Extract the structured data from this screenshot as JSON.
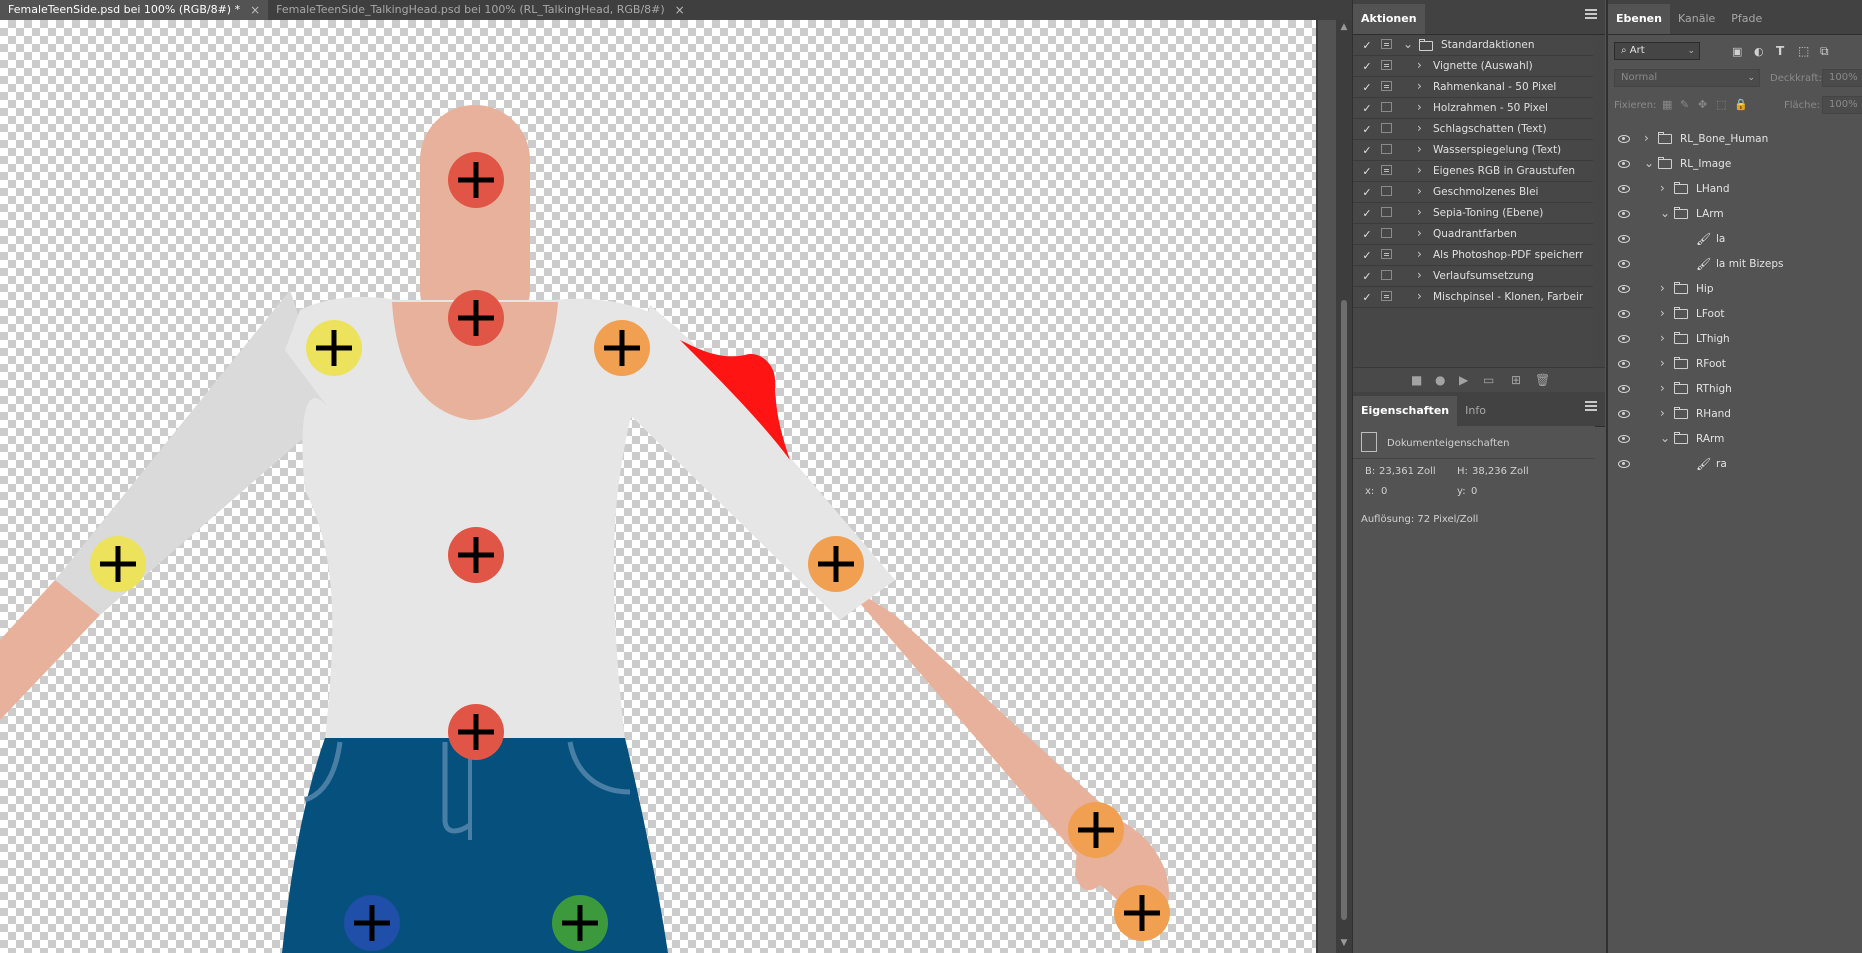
{
  "tabs": [
    {
      "label": "FemaleTeenSide.psd bei 100% (RGB/8#) *",
      "close": "×",
      "active": true
    },
    {
      "label": "FemaleTeenSide_TalkingHead.psd bei 100% (RL_TalkingHead, RGB/8#)",
      "close": "×",
      "active": false
    }
  ],
  "actions": {
    "tab_label": "Aktionen",
    "set": {
      "label": "Standardaktionen",
      "checked": true
    },
    "items": [
      {
        "label": "Vignette (Auswahl)",
        "dialog": true
      },
      {
        "label": "Rahmenkanal - 50 Pixel",
        "dialog": true
      },
      {
        "label": "Holzrahmen - 50 Pixel",
        "dialog": false
      },
      {
        "label": "Schlagschatten (Text)",
        "dialog": false
      },
      {
        "label": "Wasserspiegelung (Text)",
        "dialog": false
      },
      {
        "label": "Eigenes RGB in Graustufen",
        "dialog": true
      },
      {
        "label": "Geschmolzenes Blei",
        "dialog": false
      },
      {
        "label": "Sepia-Toning (Ebene)",
        "dialog": false
      },
      {
        "label": "Quadrantfarben",
        "dialog": false
      },
      {
        "label": "Als Photoshop-PDF speichern",
        "dialog": true
      },
      {
        "label": "Verlaufsumsetzung",
        "dialog": false
      },
      {
        "label": "Mischpinsel - Klonen, Farbeinr...",
        "dialog": true
      }
    ],
    "toolbar_icons": [
      "stop-icon",
      "record-icon",
      "play-icon",
      "new-set-icon",
      "new-action-icon",
      "delete-icon"
    ]
  },
  "properties": {
    "tabs": [
      "Eigenschaften",
      "Info"
    ],
    "section_title": "Dokumenteigenschaften",
    "width_label": "B:",
    "width_value": "23,361 Zoll",
    "height_label": "H:",
    "height_value": "38,236 Zoll",
    "x_label": "x:",
    "x_value": "0",
    "y_label": "y:",
    "y_value": "0",
    "resolution": "Auflösung: 72 Pixel/Zoll"
  },
  "layers": {
    "tabs": [
      "Ebenen",
      "Kanäle",
      "Pfade"
    ],
    "filter_kind": "Art",
    "blend_mode": "Normal",
    "opacity_label": "Deckkraft:",
    "opacity_value": "100%",
    "lock_label": "Fixieren:",
    "fill_label": "Fläche:",
    "fill_value": "100%",
    "items": [
      {
        "name": "RL_Bone_Human",
        "type": "group",
        "expanded": false,
        "depth": 0
      },
      {
        "name": "RL_Image",
        "type": "group",
        "expanded": true,
        "depth": 0
      },
      {
        "name": "LHand",
        "type": "group",
        "expanded": false,
        "depth": 1
      },
      {
        "name": "LArm",
        "type": "group",
        "expanded": true,
        "depth": 1
      },
      {
        "name": "la",
        "type": "layer",
        "depth": 2
      },
      {
        "name": "la mit Bizeps",
        "type": "layer",
        "depth": 2
      },
      {
        "name": "Hip",
        "type": "group",
        "expanded": false,
        "depth": 1
      },
      {
        "name": "LFoot",
        "type": "group",
        "expanded": false,
        "depth": 1
      },
      {
        "name": "LThigh",
        "type": "group",
        "expanded": false,
        "depth": 1
      },
      {
        "name": "RFoot",
        "type": "group",
        "expanded": false,
        "depth": 1
      },
      {
        "name": "RThigh",
        "type": "group",
        "expanded": false,
        "depth": 1
      },
      {
        "name": "RHand",
        "type": "group",
        "expanded": false,
        "depth": 1
      },
      {
        "name": "RArm",
        "type": "group",
        "expanded": true,
        "depth": 1
      },
      {
        "name": "ra",
        "type": "layer",
        "depth": 2
      }
    ]
  },
  "colors": {
    "skin": "#e8b19b",
    "shirt": "#e6e6e6",
    "shirt_shade": "#dadada",
    "jeans": "#06507e",
    "marker_red": "#e05545",
    "marker_yellow": "#ece25c",
    "marker_orange": "#f0a050",
    "marker_blue": "#1f4fa8",
    "marker_green": "#3c9a3c",
    "accent_red": "#ff1414"
  },
  "canvas": {
    "markers": [
      "red",
      "red",
      "yellow",
      "orange",
      "red",
      "yellow",
      "orange",
      "red",
      "orange",
      "orange",
      "blue",
      "green"
    ]
  }
}
